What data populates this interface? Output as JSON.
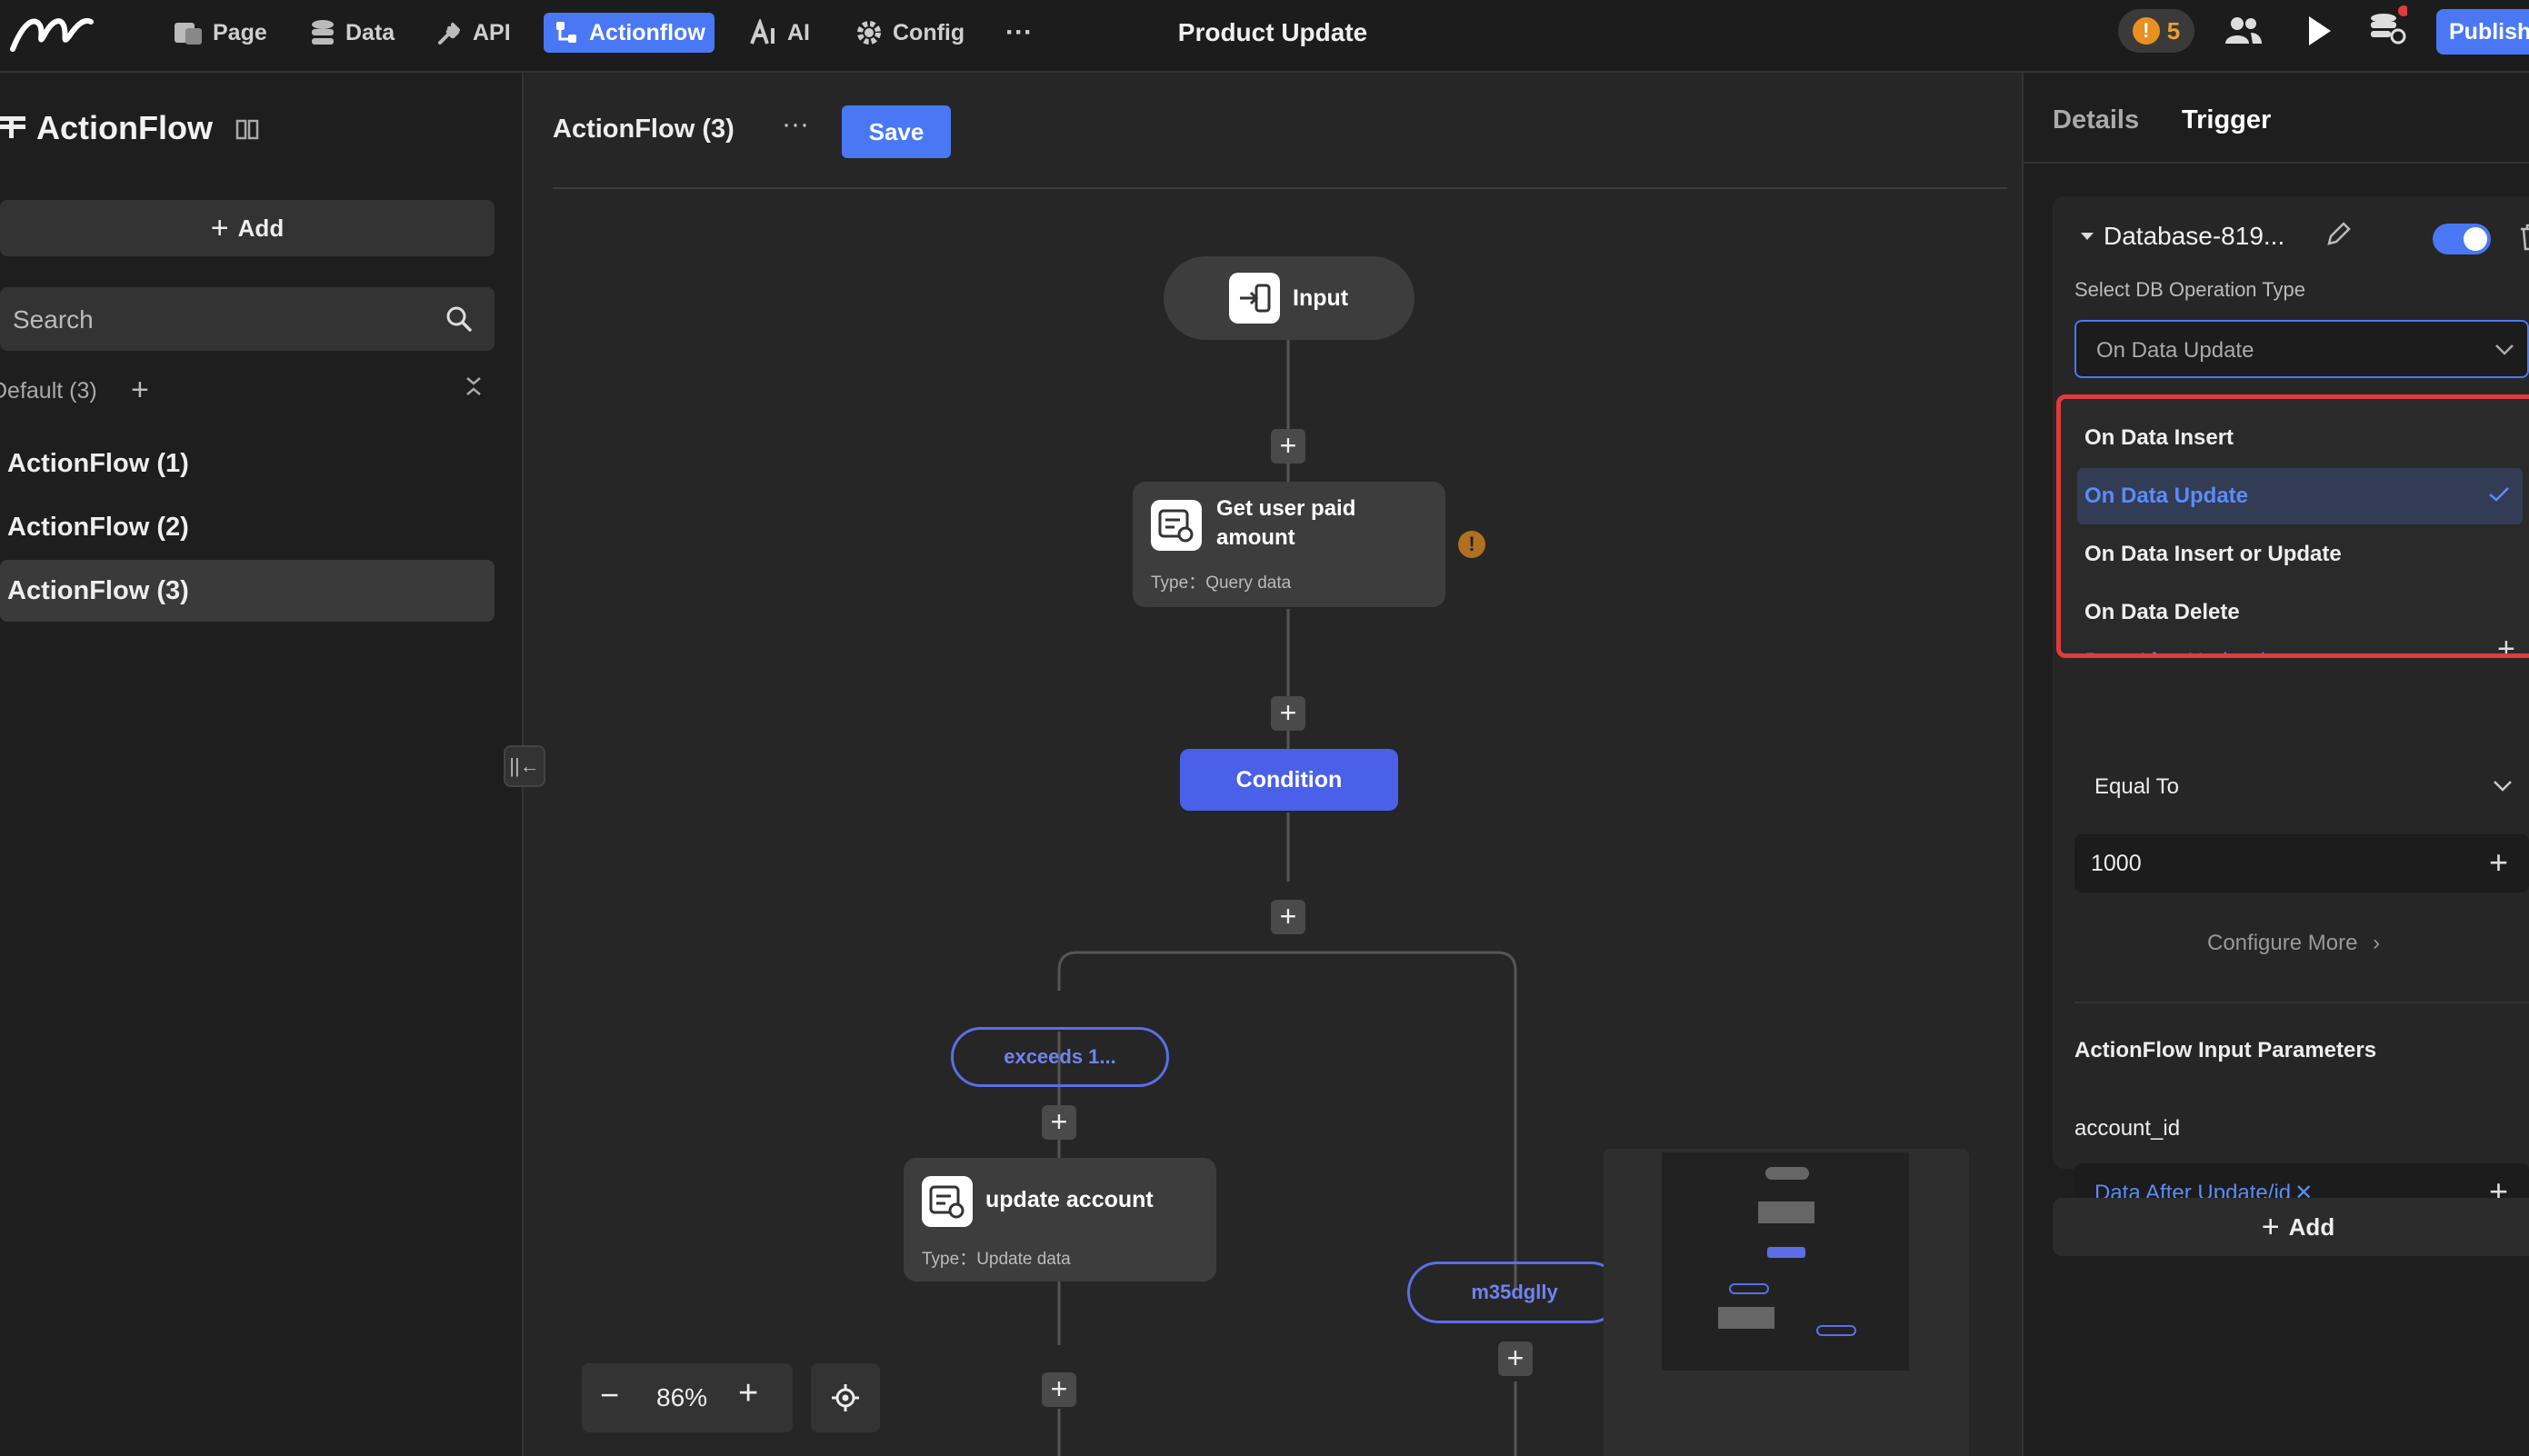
{
  "topbar": {
    "nav": [
      {
        "label": "Page",
        "icon": "page-icon"
      },
      {
        "label": "Data",
        "icon": "database-icon"
      },
      {
        "label": "API",
        "icon": "plug-icon"
      },
      {
        "label": "Actionflow",
        "icon": "flow-icon",
        "active": true
      },
      {
        "label": "AI",
        "icon": "ai-icon"
      },
      {
        "label": "Config",
        "icon": "gear-icon"
      }
    ],
    "more": "···",
    "title": "Product Update",
    "warning_count": "5",
    "publish_label": "Publish"
  },
  "left": {
    "title": "ActionFlow",
    "add_label": "Add",
    "search_placeholder": "Search",
    "group_label": "Default  (3)",
    "items": [
      {
        "label": "ActionFlow  (1)"
      },
      {
        "label": "ActionFlow  (2)"
      },
      {
        "label": "ActionFlow  (3)",
        "selected": true
      }
    ]
  },
  "canvas": {
    "title": "ActionFlow  (3)",
    "more": "···",
    "save_label": "Save",
    "nodes": {
      "input": {
        "label": "Input"
      },
      "query": {
        "label_line1": "Get user paid",
        "label_line2": "amount",
        "type": "Type：Query data"
      },
      "condition": {
        "label": "Condition"
      },
      "branch1": {
        "label": "exceeds 1..."
      },
      "update": {
        "label": "update account",
        "type": "Type：Update data"
      },
      "branch2": {
        "label": "m35dglly"
      }
    },
    "zoom": "86%"
  },
  "right": {
    "tabs": [
      "Details",
      "Trigger"
    ],
    "trigger_name": "Database-819...",
    "toggle_on": true,
    "db_op_label": "Select DB Operation Type",
    "db_op_value": "On Data Update",
    "menu_options": [
      {
        "label": "On Data Insert"
      },
      {
        "label": "On Data Update",
        "selected": true
      },
      {
        "label": "On Data Insert or Update"
      },
      {
        "label": "On Data Delete"
      },
      {
        "label": "Data After Update/payment"
      }
    ],
    "operator": "Equal To",
    "value": "1000",
    "configure_more": "Configure More",
    "input_params_title": "ActionFlow Input Parameters",
    "param_name": "account_id",
    "param_value": "Data After Update/id",
    "add_label": "Add"
  },
  "colors": {
    "accent": "#4a78f5",
    "highlight": "#e03c3c",
    "warning": "#e89020"
  }
}
